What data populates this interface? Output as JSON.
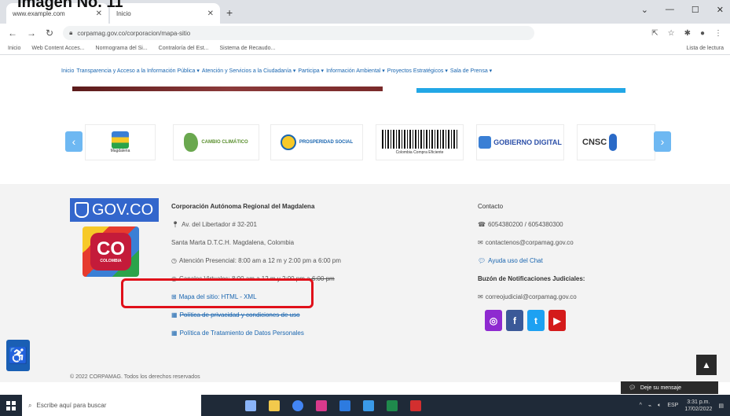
{
  "caption": "Imagen No. 11",
  "browser": {
    "tabs": [
      {
        "label": "www.example.com"
      },
      {
        "label": "Inicio"
      }
    ],
    "new_tab": "+",
    "url": "corpamag.gov.co/corporacion/mapa-sitio",
    "bookmarks": [
      "Inicio",
      "Web Content Acces...",
      "Normograma del Si...",
      "Contraloría del Est...",
      "Sistema de Recaudo..."
    ],
    "reading_list": "Lista de lectura"
  },
  "site_nav": {
    "items": [
      "Inicio",
      "Transparencia y Acceso a la Información Pública ▾",
      "Atención y Servicios a la Ciudadanía ▾",
      "Participa ▾",
      "Información Ambiental ▾",
      "Proyectos Estratégicos ▾",
      "Sala de Prensa ▾"
    ]
  },
  "carousel": {
    "prev": "‹",
    "next": "›",
    "logos": [
      {
        "label": "Magdalena"
      },
      {
        "label": "CAMBIO CLIMÁTICO"
      },
      {
        "label": "PROSPERIDAD SOCIAL"
      },
      {
        "label": "Colombia Compra Eficiente"
      },
      {
        "label": "GOBIERNO DIGITAL"
      },
      {
        "label": "CNSC"
      }
    ]
  },
  "footer": {
    "govco_label": "GOV.CO",
    "co_big": "CO",
    "co_small": "COLOMBIA",
    "org_name": "Corporación Autónoma Regional del Magdalena",
    "address": "Av. del Libertador # 32-201",
    "city": "Santa Marta D.T.C.H. Magdalena, Colombia",
    "attention_hours": "Atención Presencial: 8:00 am a 12 m y 2:00 pm a 6:00 pm",
    "virtual_hours": "Canales Virtuales: 8:00 am a 12 m y 2:00 pm a 6:00 pm",
    "sitemap_link": "Mapa del sitio: HTML - XML",
    "privacy_link": "Política de privacidad y condiciones de uso",
    "data_policy_link": "Política de Tratamiento de Datos Personales",
    "contact_title": "Contacto",
    "phones": "6054380200 / 6054380300",
    "contact_email": "contactenos@corpamag.gov.co",
    "chat_help": "Ayuda uso del Chat",
    "judicial_title": "Buzón de Notificaciones Judiciales:",
    "judicial_email": "correojudicial@corpamag.gov.co",
    "socials": [
      {
        "icon": "instagram-icon",
        "glyph": "◎",
        "color": "#8e2ad0"
      },
      {
        "icon": "facebook-icon",
        "glyph": "f",
        "color": "#3b5998"
      },
      {
        "icon": "twitter-icon",
        "glyph": "t",
        "color": "#1da1f2"
      },
      {
        "icon": "youtube-icon",
        "glyph": "▶",
        "color": "#d41a1a"
      }
    ],
    "copyright": "© 2022 CORPAMAG. Todos los derechos reservados"
  },
  "widgets": {
    "scroll_top": "▲",
    "chat_label": "Deje su mensaje",
    "accessibility": "♿"
  },
  "taskbar": {
    "search_placeholder": "Escribe aquí para buscar",
    "time": "3:31 p.m.",
    "date": "17/02/2022",
    "lang": "ESP"
  },
  "colors": {
    "highlight": "#e0101a",
    "govco_blue": "#3366cc",
    "link": "#1a66b0"
  }
}
